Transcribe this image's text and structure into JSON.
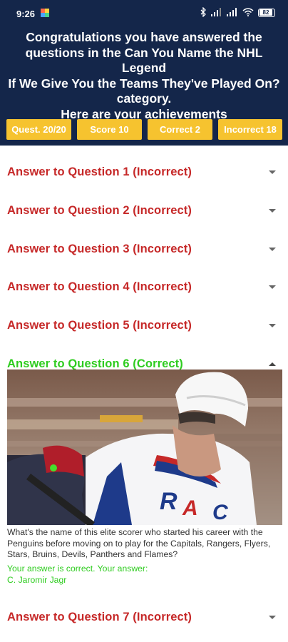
{
  "status_bar": {
    "time": "9:26",
    "battery": "82"
  },
  "header": {
    "line1": "Congratulations you have answered the",
    "line2": "questions in the Can You Name the NHL Legend",
    "line3": "If We Give You the Teams They've Played On?",
    "line4": "category.",
    "line5": "Here are your achievements"
  },
  "stats": {
    "questions": "Quest. 20/20",
    "score": "Score 10",
    "correct": "Correct 2",
    "incorrect": "Incorrect 18"
  },
  "answers": [
    {
      "label": "Answer to Question 1 (Incorrect)"
    },
    {
      "label": "Answer to Question 2 (Incorrect)"
    },
    {
      "label": "Answer to Question 3 (Incorrect)"
    },
    {
      "label": "Answer to Question 4 (Incorrect)"
    },
    {
      "label": "Answer to Question 5 (Incorrect)"
    },
    {
      "label": "Answer to Question 6 (Correct)"
    },
    {
      "label": "Answer to Question 7 (Incorrect)"
    }
  ],
  "expanded": {
    "question": "What's the name of this elite scorer who started his career with the Penguins before moving on to play for the Capitals, Rangers, Flyers, Stars, Bruins, Devils, Panthers and Flames?",
    "result_line1": "Your answer is correct. Your answer:",
    "result_line2": "C. Jaromir Jagr"
  },
  "colors": {
    "header_bg": "#14264a",
    "stat_bg": "#f6c32f",
    "incorrect": "#c62828",
    "correct": "#2ecc1f"
  }
}
